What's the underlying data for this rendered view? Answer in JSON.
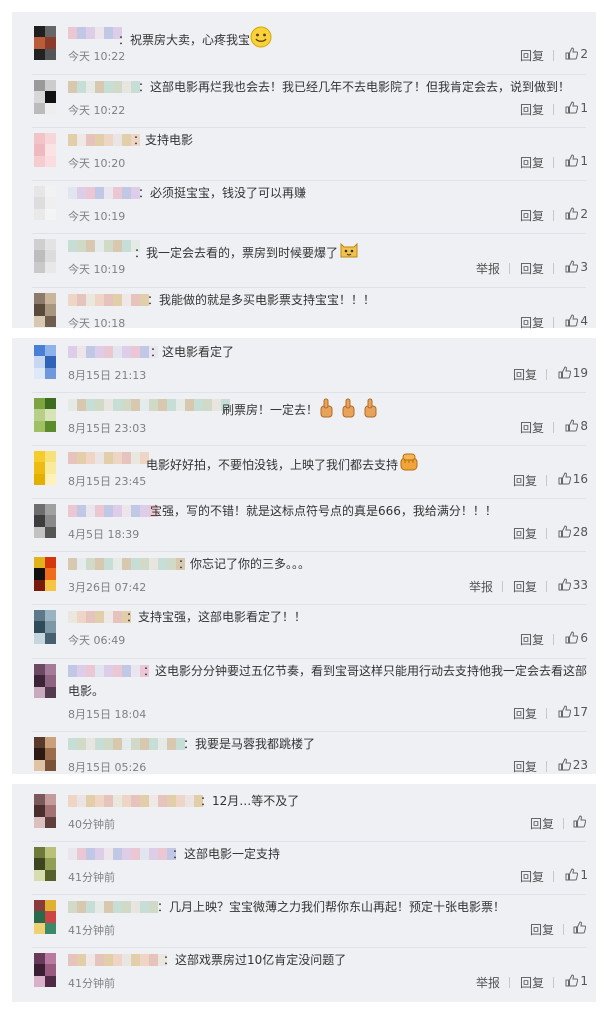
{
  "ui": {
    "reply": "回复",
    "report": "举报"
  },
  "panels": [
    {
      "comments": [
        {
          "text": "：祝票房大卖，心疼我宝",
          "emoji": "smile",
          "time": "今天 10:22",
          "likes": "2",
          "report": false
        },
        {
          "text": "：这部电影再烂我也会去！我已经几年不去电影院了！但我肯定会去，说到做到！",
          "time": "今天 10:22",
          "likes": "1",
          "report": false
        },
        {
          "text": "：支持电影",
          "time": "今天 10:20",
          "likes": "1",
          "report": false
        },
        {
          "text": "：必须挺宝宝，钱没了可以再赚",
          "time": "今天 10:19",
          "likes": "2",
          "report": false
        },
        {
          "text": "：我一定会去看的，票房到时候要爆了",
          "emoji": "cat",
          "time": "今天 10:19",
          "likes": "3",
          "report": true
        },
        {
          "text": "：我能做的就是多买电影票支持宝宝！！！",
          "time": "今天 10:18",
          "likes": "4",
          "report": false
        }
      ]
    },
    {
      "comments": [
        {
          "text": "：这电影看定了",
          "time": "8月15日 21:13",
          "likes": "19",
          "report": false
        },
        {
          "text": "刷票房！一定去！",
          "emoji": "thumbs3",
          "time": "8月15日 23:03",
          "likes": "8",
          "report": false
        },
        {
          "text": "电影好好拍，不要怕没钱，上映了我们都去支持",
          "emoji": "fist",
          "time": "8月15日 23:45",
          "likes": "16",
          "report": false
        },
        {
          "text": "宝强，写的不错！就是这标点符号点的真是666，我给满分！！！",
          "time": "4月5日 18:39",
          "likes": "28",
          "report": false
        },
        {
          "text": "：你忘记了你的三多。。。",
          "time": "3月26日 07:42",
          "likes": "33",
          "report": true
        },
        {
          "text": "：支持宝强，这部电影看定了！！",
          "time": "今天 06:49",
          "likes": "6",
          "report": false
        },
        {
          "text": "：这电影分分钟要过五亿节奏，看到宝哥这样只能用行动去支持他我一定会去看这部",
          "text2": "电影。",
          "time": "8月15日 18:04",
          "likes": "17",
          "report": false
        },
        {
          "text": "：我要是马蓉我都跳楼了",
          "time": "8月15日 05:26",
          "likes": "23",
          "report": false
        }
      ]
    },
    {
      "comments": [
        {
          "text": "：12月…等不及了",
          "time": "40分钟前",
          "likes": "",
          "report": false
        },
        {
          "text": "：这部电影一定支持",
          "time": "41分钟前",
          "likes": "1",
          "report": false
        },
        {
          "text": "：几月上映？宝宝微薄之力我们帮你东山再起！预定十张电影票！",
          "time": "41分钟前",
          "likes": "",
          "report": false
        },
        {
          "text": "：这部戏票房过10亿肯定没问题了",
          "time": "41分钟前",
          "likes": "1",
          "report": true
        }
      ]
    }
  ]
}
